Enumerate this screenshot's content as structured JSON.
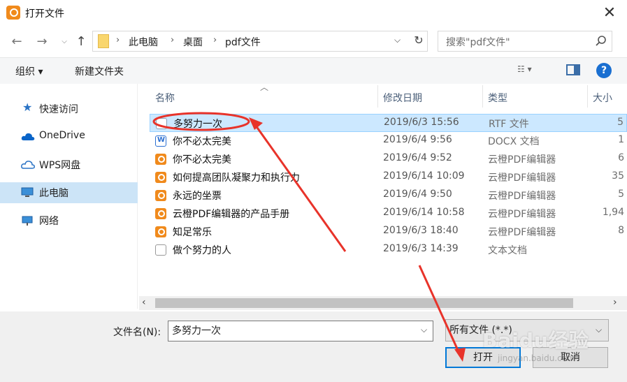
{
  "window": {
    "title": "打开文件"
  },
  "nav": {
    "path": [
      "此电脑",
      "桌面",
      "pdf文件"
    ],
    "search_placeholder": "搜索\"pdf文件\""
  },
  "toolbar": {
    "organize": "组织",
    "new_folder": "新建文件夹"
  },
  "sidebar": {
    "items": [
      {
        "label": "快速访问",
        "icon": "star-icon"
      },
      {
        "label": "OneDrive",
        "icon": "cloud-icon"
      },
      {
        "label": "WPS网盘",
        "icon": "cloud-outline-icon"
      },
      {
        "label": "此电脑",
        "icon": "computer-icon",
        "selected": true
      },
      {
        "label": "网络",
        "icon": "network-icon"
      }
    ]
  },
  "columns": {
    "name": "名称",
    "date": "修改日期",
    "type": "类型",
    "size": "大小"
  },
  "files": [
    {
      "name": "多努力一次",
      "date": "2019/6/3 15:56",
      "type": "RTF 文件",
      "size": "5",
      "icon": "document-icon",
      "selected": true
    },
    {
      "name": "你不必太完美",
      "date": "2019/6/4 9:56",
      "type": "DOCX 文档",
      "size": "1",
      "icon": "docx-icon"
    },
    {
      "name": "你不必太完美",
      "date": "2019/6/4 9:52",
      "type": "云橙PDF编辑器",
      "size": "6",
      "icon": "pdf-icon"
    },
    {
      "name": "如何提高团队凝聚力和执行力",
      "date": "2019/6/14 10:09",
      "type": "云橙PDF编辑器",
      "size": "35",
      "icon": "pdf-icon"
    },
    {
      "name": "永远的坐票",
      "date": "2019/6/4 9:50",
      "type": "云橙PDF编辑器",
      "size": "5",
      "icon": "pdf-icon"
    },
    {
      "name": "云橙PDF编辑器的产品手册",
      "date": "2019/6/14 10:58",
      "type": "云橙PDF编辑器",
      "size": "1,94",
      "icon": "pdf-icon"
    },
    {
      "name": "知足常乐",
      "date": "2019/6/3 18:40",
      "type": "云橙PDF编辑器",
      "size": "8",
      "icon": "pdf-icon"
    },
    {
      "name": "做个努力的人",
      "date": "2019/6/3 14:39",
      "type": "文本文档",
      "size": "",
      "icon": "text-file-icon"
    }
  ],
  "bottom": {
    "filename_label": "文件名(N):",
    "filename_value": "多努力一次",
    "filter": "所有文件 (*.*)",
    "open": "打开",
    "cancel": "取消"
  },
  "watermark": {
    "text": "Baidu经验",
    "sub": "jingyan.baidu.com"
  },
  "colors": {
    "selection": "#cce8ff",
    "accent": "#0078d7",
    "annotation": "#e8332a",
    "pdf_icon": "#f08a1c"
  }
}
